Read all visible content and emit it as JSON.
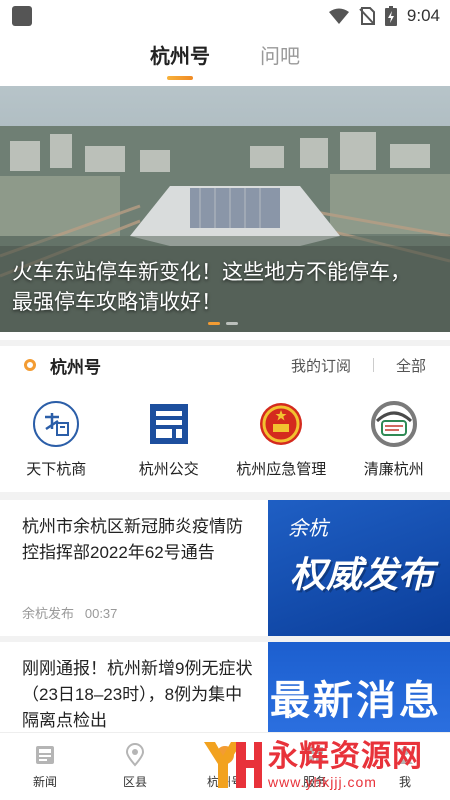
{
  "status_bar": {
    "time": "9:04"
  },
  "tabs": [
    {
      "label": "杭州号",
      "active": true
    },
    {
      "label": "问吧",
      "active": false
    }
  ],
  "banner": {
    "title": "火车东站停车新变化！这些地方不能停车，最强停车攻略请收好！",
    "active_slide": 1,
    "slide_count": 2
  },
  "section": {
    "title": "杭州号",
    "subscriptions_label": "我的订阅",
    "all_label": "全部"
  },
  "channels": [
    {
      "name": "天下杭商",
      "icon": "tianxia-hangshang-logo-icon"
    },
    {
      "name": "杭州公交",
      "icon": "hangzhou-bus-logo-icon"
    },
    {
      "name": "杭州应急管理",
      "icon": "national-emblem-icon"
    },
    {
      "name": "清廉杭州",
      "icon": "qinglian-hangzhou-logo-icon"
    }
  ],
  "articles": [
    {
      "title": "杭州市余杭区新冠肺炎疫情防控指挥部2022年62号通告",
      "source": "余杭发布",
      "time": "00:37",
      "image_text": "权威发布",
      "image_logo": "余杭"
    },
    {
      "title": "刚刚通报！杭州新增9例无症状（23日18–23时），8例为集中隔离点检出",
      "image_text": "最新消息"
    }
  ],
  "bottom_nav": [
    {
      "label": "新闻",
      "icon": "news-icon"
    },
    {
      "label": "区县",
      "icon": "location-pin-icon"
    },
    {
      "label": "杭州号",
      "icon": "hangzhou-hao-icon"
    },
    {
      "label": "服务",
      "icon": "service-icon"
    },
    {
      "label": "我",
      "icon": "user-icon"
    }
  ],
  "watermark": {
    "text": "永辉资源网",
    "url": "www.yhkjjj.com"
  },
  "colors": {
    "accent": "#f39c33",
    "article_image_blue": "#1f5fc4",
    "watermark_red": "#e8323a"
  }
}
